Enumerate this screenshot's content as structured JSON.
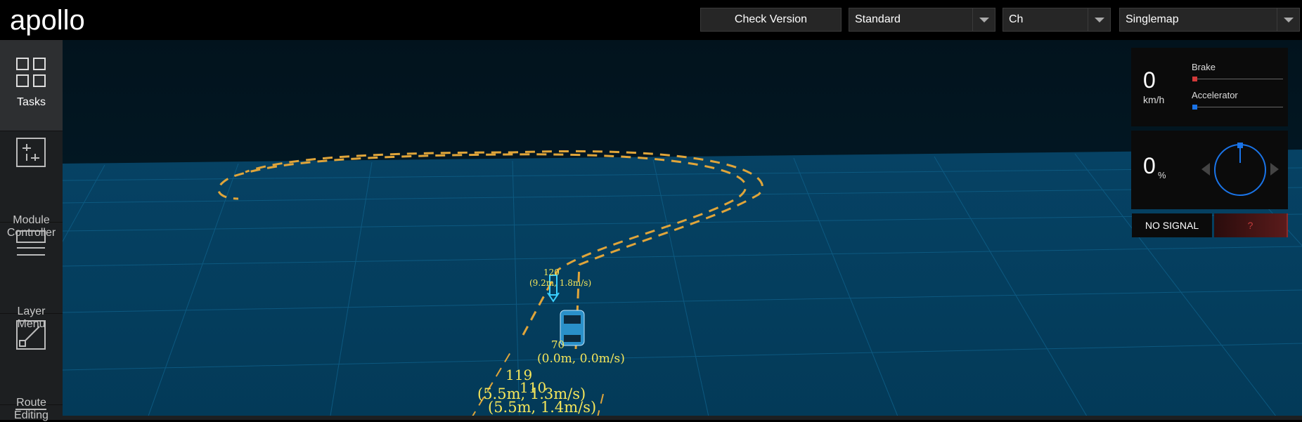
{
  "header": {
    "logo_text": "apollo",
    "check_version_label": "Check Version",
    "mode_select": "Standard",
    "language_select": "Ch",
    "map_select": "Singlemap"
  },
  "sidebar": {
    "items": [
      {
        "label": "Tasks",
        "icon": "grid-icon",
        "active": true
      },
      {
        "label": "Module Controller",
        "icon": "sliders-icon",
        "active": false
      },
      {
        "label": "Layer Menu",
        "icon": "layers-icon",
        "active": false
      },
      {
        "label": "Route Editing",
        "icon": "route-icon",
        "active": false
      }
    ]
  },
  "dashboard": {
    "speed_value": "0",
    "speed_unit": "km/h",
    "brake_label": "Brake",
    "brake_level": 0,
    "accelerator_label": "Accelerator",
    "accelerator_level": 0,
    "steering_value": "0",
    "steering_unit": "%",
    "signal_status": "NO SIGNAL",
    "signal_indicator": "?"
  },
  "scene_labels": [
    {
      "text": "120"
    },
    {
      "text": "(9.2m, 1.8m/s)"
    },
    {
      "text": "70"
    },
    {
      "text": "(0.0m, 0.0m/s)"
    },
    {
      "text": "119"
    },
    {
      "text": "(5.5m, 1.3m/s)"
    },
    {
      "text": "110"
    },
    {
      "text": "(5.5m, 1.4m/s)"
    }
  ],
  "colors": {
    "accent_blue": "#1a74e8",
    "lane_orange": "#e0a53a",
    "label_yellow": "#f5e65a",
    "brake_red": "#d33a3a",
    "grid_blue": "#0b5277"
  }
}
